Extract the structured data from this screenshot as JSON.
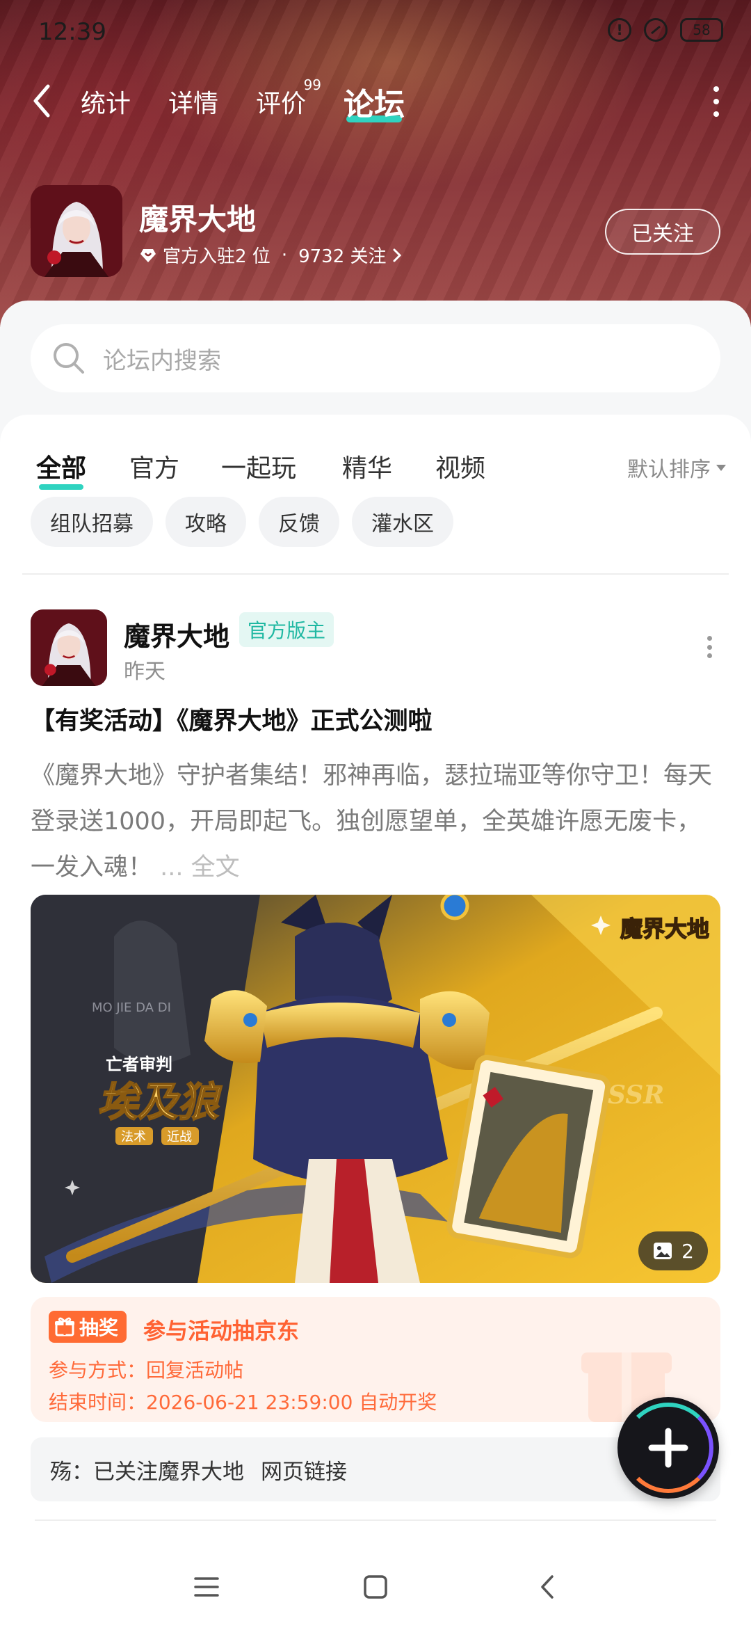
{
  "status_bar": {
    "time": "12:39",
    "battery": "58"
  },
  "nav": {
    "tabs": [
      {
        "label": "统计"
      },
      {
        "label": "详情"
      },
      {
        "label": "评价",
        "badge": "99"
      },
      {
        "label": "论坛",
        "active": true
      }
    ]
  },
  "game": {
    "name": "魔界大地",
    "official_count": "官方入驻2 位",
    "separator": "·",
    "follow_count": "9732 关注",
    "follow_button": "已关注"
  },
  "search": {
    "placeholder": "论坛内搜索"
  },
  "filter_tabs": [
    "全部",
    "官方",
    "一起玩",
    "精华",
    "视频"
  ],
  "sort_label": "默认排序",
  "chips": [
    "组队招募",
    "攻略",
    "反馈",
    "灌水区"
  ],
  "post": {
    "author": "魔界大地",
    "badge": "官方版主",
    "time": "昨天",
    "title": "【有奖活动】《魔界大地》正式公测啦",
    "body": "《魔界大地》守护者集结！邪神再临，瑟拉瑞亚等你守卫！每天登录送1000，开局即起飞。独创愿望单，全英雄许愿无废卡，一发入魂！",
    "more_label": "... 全文",
    "image_count": "2",
    "image_text": {
      "hero_small": "亡者审判",
      "hero_name": "埃及狼",
      "tag1": "法术",
      "tag2": "近战",
      "logo": "魔界大地",
      "tiny": "MO JIE DA DI"
    }
  },
  "lottery": {
    "tag": "抽奖",
    "title": "参与活动抽京东",
    "method": "参与方式：回复活动帖",
    "end_time": "结束时间：2026-06-21 23:59:00 自动开奖"
  },
  "comment": {
    "text": "殇：已关注魔界大地",
    "link": "网页链接"
  },
  "colors": {
    "accent": "#2fd3c0",
    "lottery_orange": "#ff6233"
  }
}
